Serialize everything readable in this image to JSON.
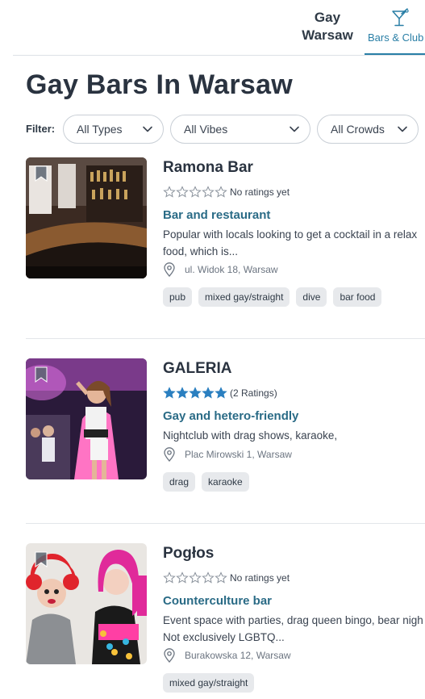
{
  "header": {
    "city_line1": "Gay",
    "city_line2": "Warsaw",
    "tab_label": "Bars & Club",
    "tab_icon": "cocktail-icon"
  },
  "page_title": "Gay Bars In Warsaw",
  "filters": {
    "label": "Filter:",
    "types": "All Types",
    "vibes": "All Vibes",
    "crowds": "All Crowds"
  },
  "accent_color": "#2a7fa6",
  "listings": [
    {
      "name": "Ramona Bar",
      "rating_stars": 0,
      "rating_text": "No ratings yet",
      "category": "Bar and restaurant",
      "desc_line1": "Popular with locals looking to get a cocktail in a relax",
      "desc_line2": "food, which is...",
      "address": "ul. Widok 18, Warsaw",
      "tags": [
        "pub",
        "mixed gay/straight",
        "dive",
        "bar food"
      ]
    },
    {
      "name": "GALERIA",
      "rating_stars": 5,
      "rating_text": "(2 Ratings)",
      "category": "Gay and hetero-friendly",
      "desc_line1": "Nightclub with drag shows, karaoke,",
      "address": "Plac Mirowski 1, Warsaw",
      "tags": [
        "drag",
        "karaoke"
      ]
    },
    {
      "name": "Pogłos",
      "rating_stars": 0,
      "rating_text": "No ratings yet",
      "category": "Counterculture bar",
      "desc_line1": "Event space with parties, drag queen bingo, bear nigh",
      "desc_line2": "Not exclusively LGBTQ...",
      "address": "Burakowska 12, Warsaw",
      "tags": [
        "mixed gay/straight"
      ]
    }
  ]
}
